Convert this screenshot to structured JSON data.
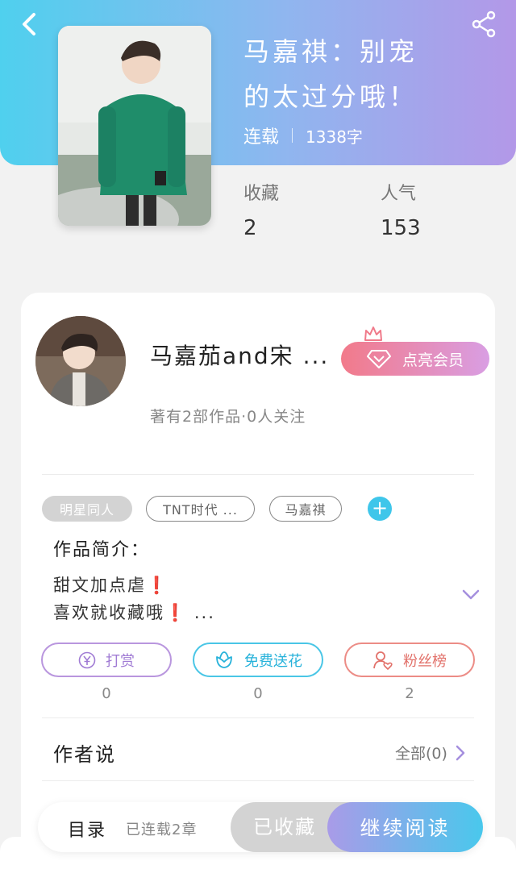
{
  "header": {
    "title_line1": "马嘉祺：别宠",
    "title_line2": "的太过分哦！",
    "status": "连载",
    "word_count": "1338字"
  },
  "stats": {
    "favorites_label": "收藏",
    "favorites_value": "2",
    "popularity_label": "人气",
    "popularity_value": "153"
  },
  "author": {
    "name": "马嘉茄and宋 ...",
    "subtitle": "著有2部作品·0人关注",
    "vip_label": "点亮会员"
  },
  "tags": [
    "明星同人",
    "TNT时代 ...",
    "马嘉祺"
  ],
  "intro": {
    "title": "作品简介：",
    "line1": "甜文加点虐",
    "line2": "喜欢就收藏哦",
    "line2_suffix": "..."
  },
  "actions": [
    {
      "label": "打赏",
      "count": "0",
      "icon": "yen-coin-icon"
    },
    {
      "label": "免费送花",
      "count": "0",
      "icon": "flower-icon"
    },
    {
      "label": "粉丝榜",
      "count": "2",
      "icon": "user-heart-icon"
    }
  ],
  "author_says": {
    "title": "作者说",
    "all_label": "全部(0)"
  },
  "bottom": {
    "toc_label": "目录",
    "toc_sub": "已连载2章",
    "collected_label": "已收藏",
    "read_label": "继续阅读"
  },
  "colors": {
    "header_start": "#4fd0ee",
    "header_end": "#b398e8",
    "accent_cyan": "#3fc6ea",
    "accent_purple": "#a07bd4",
    "accent_red": "#e2716a"
  }
}
